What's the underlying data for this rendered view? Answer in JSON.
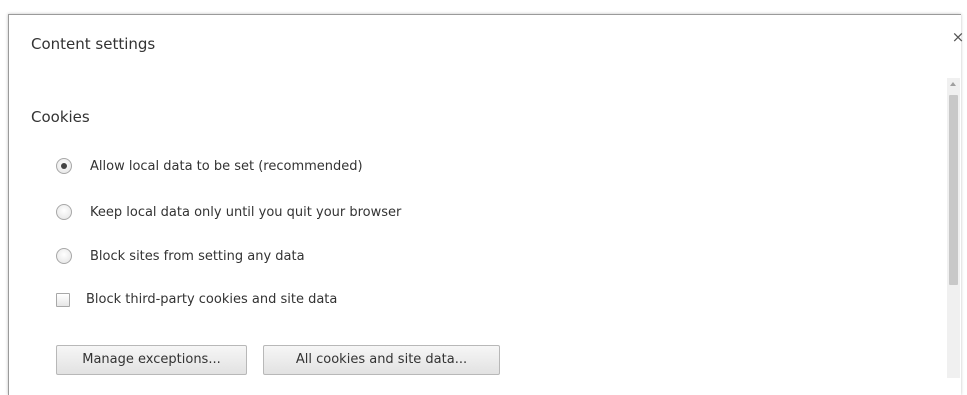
{
  "dialog": {
    "title": "Content settings",
    "close_label": "×"
  },
  "cookies": {
    "heading": "Cookies",
    "options": [
      {
        "label": "Allow local data to be set (recommended)",
        "selected": true
      },
      {
        "label": "Keep local data only until you quit your browser",
        "selected": false
      },
      {
        "label": "Block sites from setting any data",
        "selected": false
      }
    ],
    "third_party": {
      "label": "Block third-party cookies and site data",
      "checked": false
    },
    "buttons": {
      "manage_exceptions": "Manage exceptions...",
      "all_cookies": "All cookies and site data..."
    }
  }
}
